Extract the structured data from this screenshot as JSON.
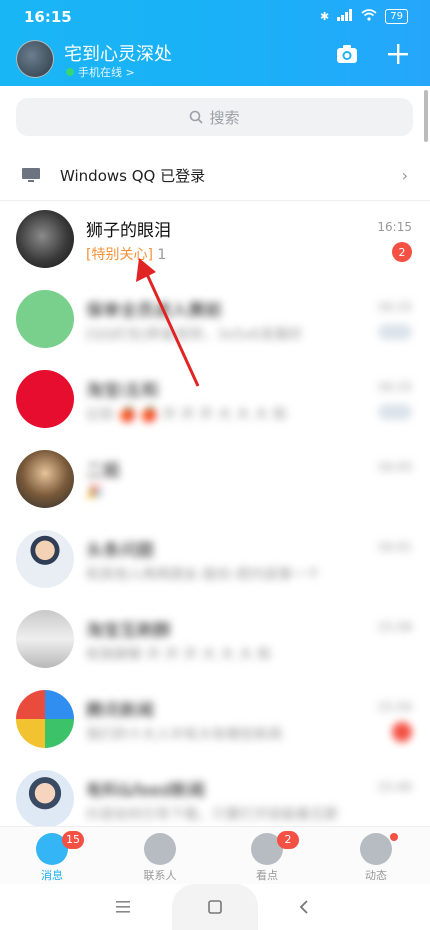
{
  "status_bar": {
    "time": "16:15",
    "battery": "79"
  },
  "header": {
    "nickname": "宅到心灵深处",
    "online_status": "手机在线 >"
  },
  "search": {
    "placeholder": "搜索"
  },
  "windows_qq": {
    "label": "Windows QQ 已登录"
  },
  "chats": [
    {
      "name": "狮子的眼泪",
      "tag": "[特别关心]",
      "message": "1",
      "time": "16:15",
      "badge": "2"
    },
    {
      "name": "保单全员进入赛前",
      "message": "[QQ红包]恭喜发财，3x5x6发展好",
      "time": "16:15",
      "blurred": true
    },
    {
      "name": "淘宝i五和",
      "message": "比较 🍎 🍎 开 开 开 大 大 大 和 ",
      "time": "16:15",
      "blurred": true
    },
    {
      "name": "二姐",
      "message": "🎉",
      "time": "16:03",
      "blurred": true
    },
    {
      "name": "头条问题",
      "message": "和其他人两两朋友-股份-把内容第一个",
      "time": "16:01",
      "blurred": true
    },
    {
      "name": "淘宝互刷群",
      "message": "和我聊聊 开 开 开 大 大 大 和 ",
      "time": "15:58",
      "blurred": true
    },
    {
      "name": "腾讯新闻",
      "message": "我们的十大人中有大有哪些新闻",
      "time": "15:50",
      "blurred": true
    },
    {
      "name": "有料&feed新闻",
      "message": "抖音如何引导下载，只要打开就能看见那",
      "time": "15:40",
      "blurred": true
    }
  ],
  "tabs": [
    {
      "label": "消息",
      "badge": "15"
    },
    {
      "label": "联系人"
    },
    {
      "label": "看点",
      "badge": "2"
    },
    {
      "label": "动态"
    }
  ],
  "colors": {
    "header": "#1bb0f8",
    "badge": "#f45044",
    "special_care": "#f7923a",
    "annotation_arrow": "#e02323"
  }
}
